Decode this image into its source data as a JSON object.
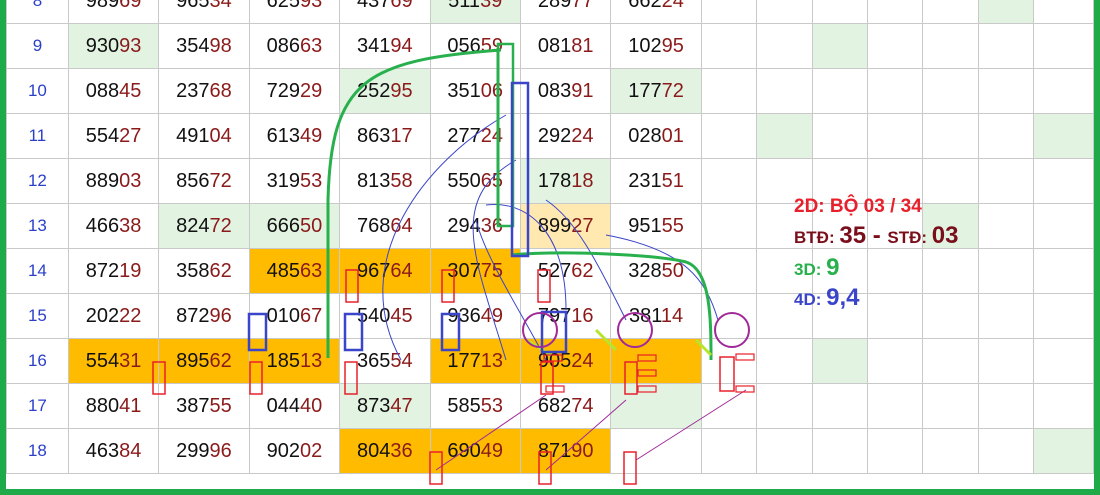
{
  "rows": [
    {
      "label": "8",
      "cells": [
        {
          "head": "989",
          "tail": "69",
          "bg": ""
        },
        {
          "head": "965",
          "tail": "34",
          "bg": ""
        },
        {
          "head": "625",
          "tail": "93",
          "bg": ""
        },
        {
          "head": "437",
          "tail": "69",
          "bg": ""
        },
        {
          "head": "511",
          "tail": "39",
          "bg": "lg"
        },
        {
          "head": "289",
          "tail": "77",
          "bg": ""
        },
        {
          "head": "662",
          "tail": "24",
          "bg": ""
        }
      ],
      "ext": [
        "",
        "",
        "",
        "",
        "",
        "lg",
        ""
      ]
    },
    {
      "label": "9",
      "cells": [
        {
          "head": "930",
          "tail": "93",
          "bg": "lg"
        },
        {
          "head": "354",
          "tail": "98",
          "bg": ""
        },
        {
          "head": "086",
          "tail": "63",
          "bg": ""
        },
        {
          "head": "341",
          "tail": "94",
          "bg": ""
        },
        {
          "head": "056",
          "tail": "59",
          "bg": ""
        },
        {
          "head": "081",
          "tail": "81",
          "bg": ""
        },
        {
          "head": "102",
          "tail": "95",
          "bg": ""
        }
      ],
      "ext": [
        "",
        "",
        "lg",
        "",
        "",
        "",
        ""
      ]
    },
    {
      "label": "10",
      "cells": [
        {
          "head": "088",
          "tail": "45",
          "bg": ""
        },
        {
          "head": "237",
          "tail": "68",
          "bg": ""
        },
        {
          "head": "729",
          "tail": "29",
          "bg": ""
        },
        {
          "head": "252",
          "tail": "95",
          "bg": "lg"
        },
        {
          "head": "351",
          "tail": "06",
          "bg": ""
        },
        {
          "head": "083",
          "tail": "91",
          "bg": ""
        },
        {
          "head": "177",
          "tail": "72",
          "bg": "lg"
        }
      ],
      "ext": [
        "",
        "",
        "",
        "",
        "",
        "",
        ""
      ]
    },
    {
      "label": "11",
      "cells": [
        {
          "head": "554",
          "tail": "27",
          "bg": ""
        },
        {
          "head": "491",
          "tail": "04",
          "bg": ""
        },
        {
          "head": "613",
          "tail": "49",
          "bg": ""
        },
        {
          "head": "863",
          "tail": "17",
          "bg": ""
        },
        {
          "head": "277",
          "tail": "24",
          "bg": ""
        },
        {
          "head": "292",
          "tail": "24",
          "bg": ""
        },
        {
          "head": "028",
          "tail": "01",
          "bg": ""
        }
      ],
      "ext": [
        "",
        "lg",
        "",
        "",
        "",
        "",
        "lg"
      ]
    },
    {
      "label": "12",
      "cells": [
        {
          "head": "889",
          "tail": "03",
          "bg": ""
        },
        {
          "head": "856",
          "tail": "72",
          "bg": ""
        },
        {
          "head": "319",
          "tail": "53",
          "bg": ""
        },
        {
          "head": "813",
          "tail": "58",
          "bg": ""
        },
        {
          "head": "550",
          "tail": "65",
          "bg": ""
        },
        {
          "head": "178",
          "tail": "18",
          "bg": "lg"
        },
        {
          "head": "231",
          "tail": "51",
          "bg": ""
        }
      ],
      "ext": [
        "",
        "",
        "",
        "",
        "",
        "",
        ""
      ]
    },
    {
      "label": "13",
      "cells": [
        {
          "head": "466",
          "tail": "38",
          "bg": ""
        },
        {
          "head": "824",
          "tail": "72",
          "bg": "lg"
        },
        {
          "head": "666",
          "tail": "50",
          "bg": "lg"
        },
        {
          "head": "768",
          "tail": "64",
          "bg": ""
        },
        {
          "head": "294",
          "tail": "36",
          "bg": ""
        },
        {
          "head": "899",
          "tail": "27",
          "bg": "cr"
        },
        {
          "head": "951",
          "tail": "55",
          "bg": ""
        }
      ],
      "ext": [
        "",
        "",
        "",
        "",
        "lg",
        "",
        ""
      ]
    },
    {
      "label": "14",
      "cells": [
        {
          "head": "872",
          "tail": "19",
          "bg": ""
        },
        {
          "head": "358",
          "tail": "62",
          "bg": ""
        },
        {
          "head": "485",
          "tail": "63",
          "bg": "hi"
        },
        {
          "head": "967",
          "tail": "64",
          "bg": "hi"
        },
        {
          "head": "307",
          "tail": "75",
          "bg": "hi"
        },
        {
          "head": "527",
          "tail": "62",
          "bg": ""
        },
        {
          "head": "328",
          "tail": "50",
          "bg": ""
        }
      ],
      "ext": [
        "",
        "",
        "",
        "",
        "",
        "",
        ""
      ]
    },
    {
      "label": "15",
      "cells": [
        {
          "head": "202",
          "tail": "22",
          "bg": ""
        },
        {
          "head": "872",
          "tail": "96",
          "bg": ""
        },
        {
          "head": "010",
          "tail": "67",
          "bg": ""
        },
        {
          "head": "540",
          "tail": "45",
          "bg": ""
        },
        {
          "head": "936",
          "tail": "49",
          "bg": ""
        },
        {
          "head": "797",
          "tail": "16",
          "bg": ""
        },
        {
          "head": "381",
          "tail": "14",
          "bg": ""
        }
      ],
      "ext": [
        "",
        "",
        "",
        "",
        "",
        "",
        ""
      ]
    },
    {
      "label": "16",
      "cells": [
        {
          "head": "554",
          "tail": "31",
          "bg": "hi"
        },
        {
          "head": "895",
          "tail": "62",
          "bg": "hi"
        },
        {
          "head": "185",
          "tail": "13",
          "bg": "hi"
        },
        {
          "head": "365",
          "tail": "54",
          "bg": ""
        },
        {
          "head": "177",
          "tail": "13",
          "bg": "hi"
        },
        {
          "head": "905",
          "tail": "24",
          "bg": "hi"
        },
        {
          "head": "",
          "tail": "",
          "bg": "hi"
        }
      ],
      "ext": [
        "",
        "",
        "lg",
        "",
        "",
        "",
        ""
      ]
    },
    {
      "label": "17",
      "cells": [
        {
          "head": "880",
          "tail": "41",
          "bg": ""
        },
        {
          "head": "387",
          "tail": "55",
          "bg": ""
        },
        {
          "head": "044",
          "tail": "40",
          "bg": ""
        },
        {
          "head": "873",
          "tail": "47",
          "bg": "lg"
        },
        {
          "head": "585",
          "tail": "53",
          "bg": ""
        },
        {
          "head": "682",
          "tail": "74",
          "bg": ""
        },
        {
          "head": "",
          "tail": "",
          "bg": "lg"
        }
      ],
      "ext": [
        "",
        "",
        "",
        "",
        "",
        "",
        ""
      ]
    },
    {
      "label": "18",
      "cells": [
        {
          "head": "463",
          "tail": "84",
          "bg": ""
        },
        {
          "head": "299",
          "tail": "96",
          "bg": ""
        },
        {
          "head": "902",
          "tail": "02",
          "bg": ""
        },
        {
          "head": "804",
          "tail": "36",
          "bg": "hi"
        },
        {
          "head": "690",
          "tail": "49",
          "bg": "hi"
        },
        {
          "head": "871",
          "tail": "90",
          "bg": "hi"
        },
        {
          "head": "",
          "tail": "",
          "bg": ""
        }
      ],
      "ext": [
        "",
        "",
        "",
        "",
        "",
        "",
        "lg"
      ]
    }
  ],
  "legend": {
    "line1": "2D: BỘ 03 / 34",
    "btd_label": "BTĐ:",
    "btd_value": "35",
    "sep": " - ",
    "std_label": "STĐ:",
    "std_value": "03",
    "d3_label": "3D:",
    "d3_value": "9",
    "d4_label": "4D:",
    "d4_value": "9,4"
  },
  "colors": {
    "highlight": "#ffbb00",
    "light_green": "#e2f3e2",
    "green_line": "#27b04c",
    "blue_box": "#3b45c9",
    "red_box": "#e8202c",
    "purple_circle": "#a02a9a",
    "frame": "#1faa4a"
  }
}
